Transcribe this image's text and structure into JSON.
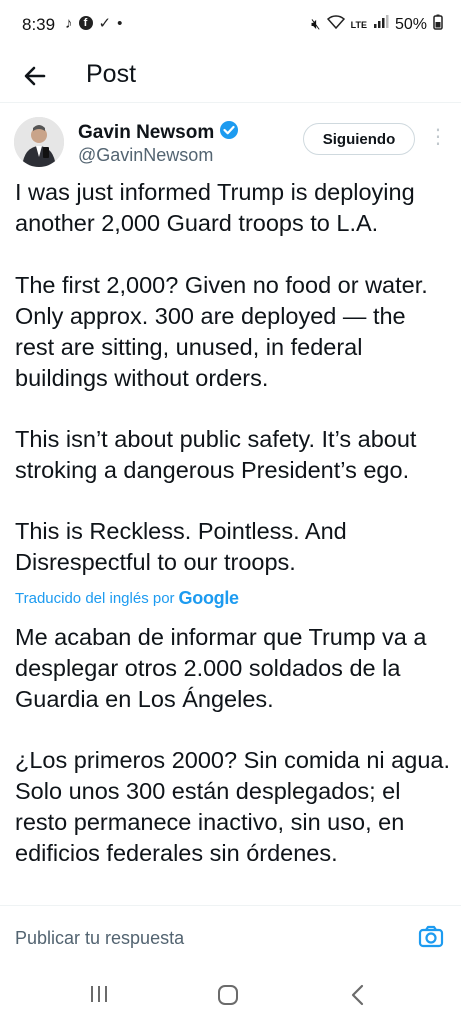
{
  "status_bar": {
    "time": "8:39",
    "battery": "50%",
    "network_label": "LTE"
  },
  "header": {
    "title": "Post"
  },
  "author": {
    "name": "Gavin Newsom",
    "handle": "@GavinNewsom",
    "follow_label": "Siguiendo",
    "verified_color": "#1d9bf0"
  },
  "post": {
    "original_paragraphs": [
      "I was just informed Trump is deploying another 2,000 Guard troops to L.A.",
      "The first 2,000? Given no food or water. Only approx. 300 are deployed — the rest are sitting, unused, in federal buildings without orders.",
      "This isn’t about public safety. It’s about stroking a dangerous President’s ego.",
      "This is Reckless. Pointless. And Disrespectful to our troops."
    ],
    "translated_by_label": "Traducido del inglés por",
    "translator_name": "Google",
    "translation_paragraphs": [
      "Me acaban de informar que Trump va a desplegar otros 2.000 soldados de la Guardia en Los Ángeles.",
      "¿Los primeros 2000? Sin comida ni agua. Solo unos 300 están desplegados; el resto permanece inactivo, sin uso, en edificios federales sin órdenes."
    ]
  },
  "reply": {
    "placeholder": "Publicar tu respuesta"
  },
  "colors": {
    "accent": "#1d9bf0",
    "text": "#0f1419",
    "secondary_text": "#536471"
  }
}
